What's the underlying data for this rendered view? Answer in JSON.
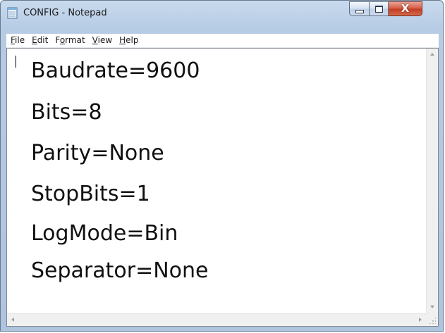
{
  "window": {
    "title": "CONFIG - Notepad",
    "icon": "notepad-icon",
    "controls": {
      "minimize_icon": "minimize-icon",
      "maximize_icon": "maximize-icon",
      "close_icon": "close-icon",
      "close_glyph": "X"
    }
  },
  "menu": {
    "items": [
      {
        "accel": "F",
        "rest": "ile"
      },
      {
        "accel": "E",
        "rest": "dit"
      },
      {
        "pre": "F",
        "accel": "o",
        "rest": "rmat"
      },
      {
        "accel": "V",
        "rest": "iew"
      },
      {
        "accel": "H",
        "rest": "elp"
      }
    ]
  },
  "document": {
    "lines": [
      "Baudrate=9600",
      "Bits=8",
      "Parity=None",
      "StopBits=1",
      "LogMode=Bin",
      "Separator=None"
    ]
  },
  "colors": {
    "frame": "#b6cbe4",
    "close_button": "#c94a31",
    "text": "#111111"
  }
}
